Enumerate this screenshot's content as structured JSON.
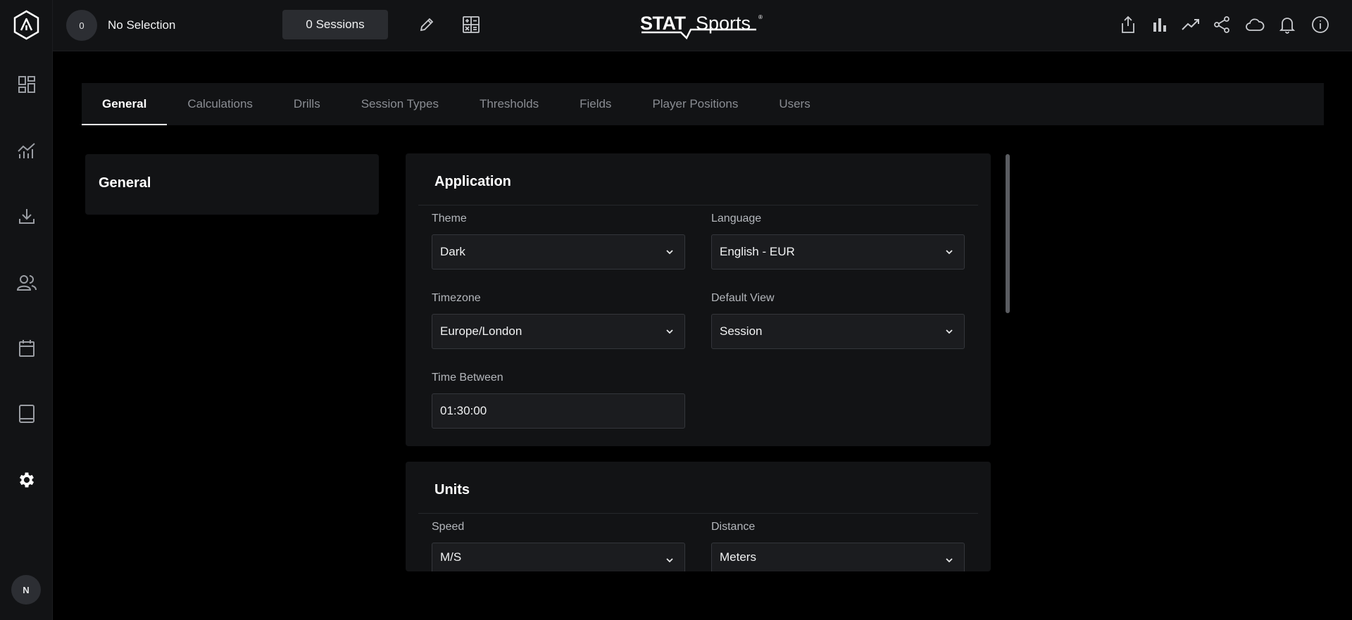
{
  "sidebar": {
    "logo_icon": "app-logo-icon",
    "items": [
      {
        "icon": "dashboard-icon"
      },
      {
        "icon": "analytics-chart-icon"
      },
      {
        "icon": "download-icon"
      },
      {
        "icon": "users-icon"
      },
      {
        "icon": "calendar-icon"
      },
      {
        "icon": "tablet-icon"
      },
      {
        "icon": "settings-gear-icon"
      }
    ],
    "avatar_initial": "N"
  },
  "topbar": {
    "selection_count": "0",
    "selection_text": "No Selection",
    "sessions_label": "0 Sessions",
    "brand": "STATSports",
    "brand_mark": "®",
    "right_icons": [
      "share-export-icon",
      "bar-chart-icon",
      "trend-icon",
      "share-icon",
      "cloud-icon",
      "bell-icon",
      "info-icon"
    ]
  },
  "tabs": [
    {
      "label": "General",
      "active": true
    },
    {
      "label": "Calculations"
    },
    {
      "label": "Drills"
    },
    {
      "label": "Session Types"
    },
    {
      "label": "Thresholds"
    },
    {
      "label": "Fields"
    },
    {
      "label": "Player Positions"
    },
    {
      "label": "Users"
    }
  ],
  "left_panel": {
    "title": "General"
  },
  "application": {
    "title": "Application",
    "theme": {
      "label": "Theme",
      "value": "Dark"
    },
    "language": {
      "label": "Language",
      "value": "English - EUR"
    },
    "timezone": {
      "label": "Timezone",
      "value": "Europe/London"
    },
    "default_view": {
      "label": "Default View",
      "value": "Session"
    },
    "time_between": {
      "label": "Time Between",
      "value": "01:30:00"
    }
  },
  "units": {
    "title": "Units",
    "speed": {
      "label": "Speed",
      "value": "M/S"
    },
    "distance": {
      "label": "Distance",
      "value": "Meters"
    }
  }
}
